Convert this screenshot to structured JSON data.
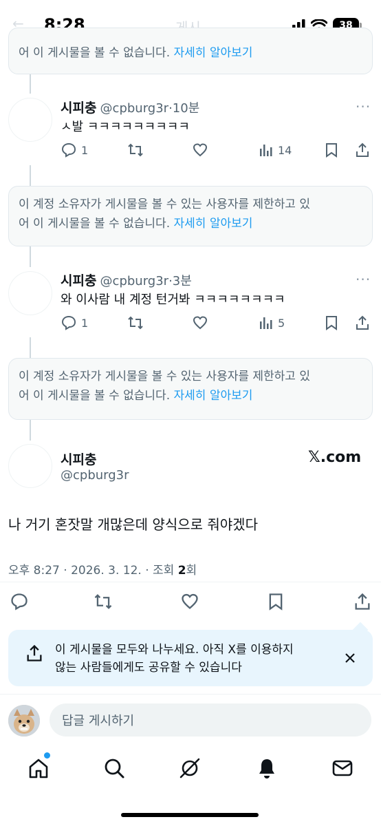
{
  "status": {
    "time": "8:28",
    "battery": "38"
  },
  "header": {
    "back": "←",
    "title": "게시"
  },
  "notice": {
    "partial": "어 이 게시물을 볼 수 없습니다.",
    "line1": "이 계정 소유자가 게시물을 볼 수 있는 사용자를 제한하고 있",
    "line2": "어 이 게시물을 볼 수 없습니다.",
    "link": "자세히 알아보기"
  },
  "replies": [
    {
      "name": "시피충",
      "handle": "@cpburg3r",
      "time": "·10분",
      "text": "ㅅ발 ㅋㅋㅋㅋㅋㅋㅋㅋㅋ",
      "replies": "1",
      "views": "14"
    },
    {
      "name": "시피충",
      "handle": "@cpburg3r",
      "time": "·3분",
      "text": "와 이사람 내 계정 턴거봐 ㅋㅋㅋㅋㅋㅋㅋㅋ",
      "replies": "1",
      "views": "5"
    }
  ],
  "more": "···",
  "main": {
    "name": "시피충",
    "handle": "@cpburg3r",
    "brand": "𝕏.com",
    "text": "나 거기 혼잣말 개많은데 양식으로 줘야겠다",
    "meta_prefix": "오후 8:27 · 2026. 3. 12. · 조회 ",
    "views": "2",
    "meta_suffix": "회"
  },
  "share": {
    "line1": "이 게시물을 모두와 나누세요. 아직 X를 이용하지",
    "line2": "않는 사람들에게도 공유할 수 있습니다"
  },
  "reply_input": {
    "placeholder": "답글 게시하기"
  },
  "colors": {
    "accent": "#1d9bf0",
    "text": "#0f1419",
    "muted": "#536471",
    "banner": "#e8f5fd"
  }
}
